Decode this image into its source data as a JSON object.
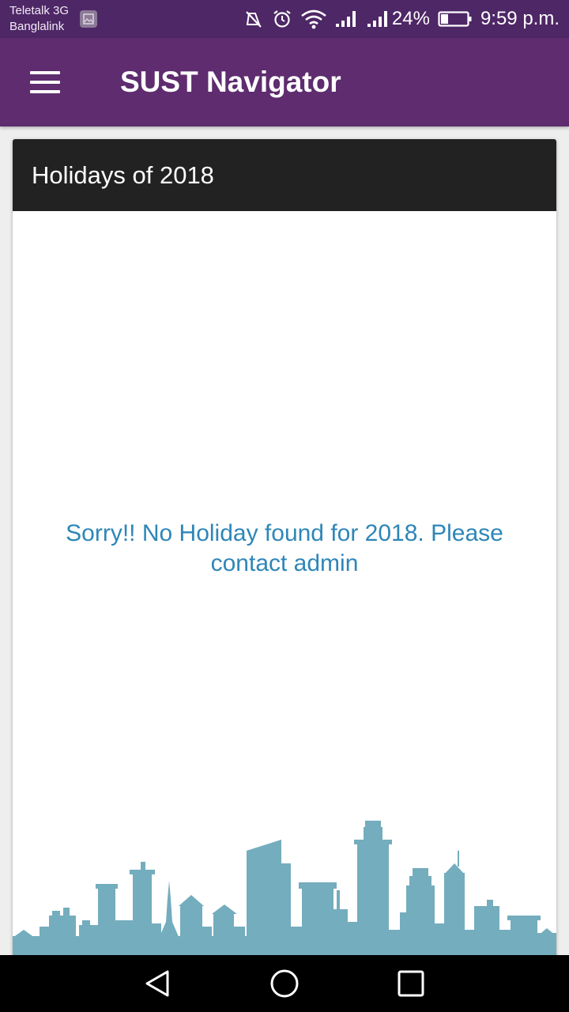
{
  "status_bar": {
    "carrier_1": "Teletalk 3G",
    "carrier_2": "Banglalink",
    "battery": "24%",
    "time": "9:59 p.m.",
    "icons": [
      "gallery-icon",
      "mute-icon",
      "alarm-icon",
      "wifi-icon",
      "signal-icon",
      "signal-icon",
      "battery-icon"
    ]
  },
  "app_bar": {
    "title": "SUST Navigator",
    "menu_icon": "hamburger-menu-icon",
    "background": "#5e2c6f"
  },
  "card": {
    "title": "Holidays of 2018",
    "empty_message": "Sorry!! No Holiday found for 2018. Please contact admin",
    "header_background": "#222222",
    "message_color": "#2e86b7",
    "illustration": "city-skyline-illustration",
    "illustration_color": "#74adbd"
  },
  "nav_bar": {
    "icons": [
      "back-icon",
      "home-icon",
      "recents-icon"
    ]
  }
}
